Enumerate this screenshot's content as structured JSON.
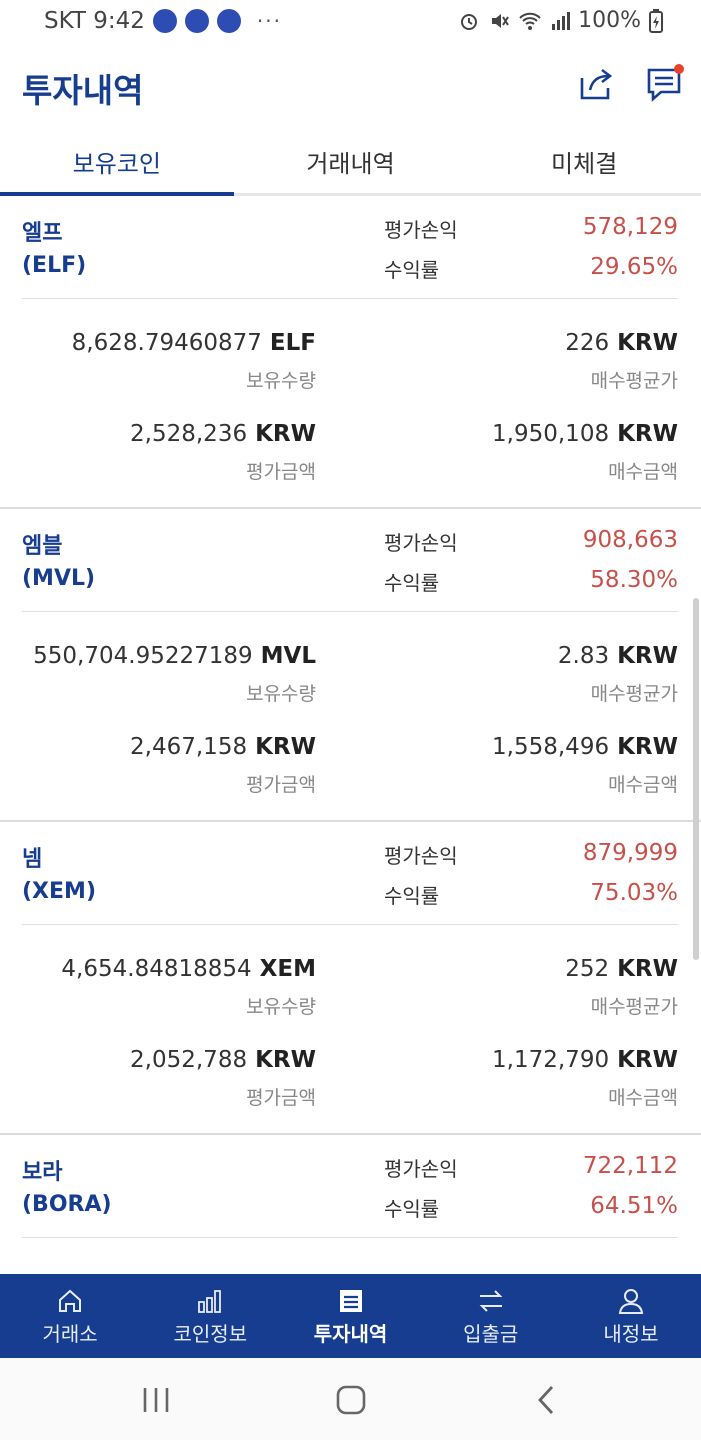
{
  "status_bar": {
    "carrier": "SKT",
    "time": "9:42",
    "more": "···",
    "battery": "100%"
  },
  "header": {
    "title": "투자내역",
    "share_icon": "share-icon",
    "chat_icon": "chat-icon"
  },
  "tabs": [
    {
      "label": "보유코인",
      "active": true
    },
    {
      "label": "거래내역",
      "active": false
    },
    {
      "label": "미체결",
      "active": false
    }
  ],
  "labels": {
    "eval_pl": "평가손익",
    "return_rate": "수익률",
    "holding_qty": "보유수량",
    "avg_price": "매수평균가",
    "eval_amount": "평가금액",
    "buy_amount": "매수금액"
  },
  "coins": [
    {
      "name": "엘프",
      "symbol": "(ELF)",
      "eval_pl": "578,129",
      "return_rate": "29.65%",
      "qty": "8,628.79460877",
      "qty_unit": "ELF",
      "avg_price": "226",
      "avg_unit": "KRW",
      "eval_amount": "2,528,236",
      "eval_unit": "KRW",
      "buy_amount": "1,950,108",
      "buy_unit": "KRW"
    },
    {
      "name": "엠블",
      "symbol": "(MVL)",
      "eval_pl": "908,663",
      "return_rate": "58.30%",
      "qty": "550,704.95227189",
      "qty_unit": "MVL",
      "avg_price": "2.83",
      "avg_unit": "KRW",
      "eval_amount": "2,467,158",
      "eval_unit": "KRW",
      "buy_amount": "1,558,496",
      "buy_unit": "KRW"
    },
    {
      "name": "넴",
      "symbol": "(XEM)",
      "eval_pl": "879,999",
      "return_rate": "75.03%",
      "qty": "4,654.84818854",
      "qty_unit": "XEM",
      "avg_price": "252",
      "avg_unit": "KRW",
      "eval_amount": "2,052,788",
      "eval_unit": "KRW",
      "buy_amount": "1,172,790",
      "buy_unit": "KRW"
    },
    {
      "name": "보라",
      "symbol": "(BORA)",
      "eval_pl": "722,112",
      "return_rate": "64.51%"
    }
  ],
  "bottom_nav": [
    {
      "label": "거래소",
      "icon": "home-icon",
      "active": false
    },
    {
      "label": "코인정보",
      "icon": "bar-chart-icon",
      "active": false
    },
    {
      "label": "투자내역",
      "icon": "document-icon",
      "active": true
    },
    {
      "label": "입출금",
      "icon": "transfer-icon",
      "active": false
    },
    {
      "label": "내정보",
      "icon": "person-icon",
      "active": false
    }
  ],
  "colors": {
    "brand": "#163d8f",
    "profit": "#c8504a"
  }
}
